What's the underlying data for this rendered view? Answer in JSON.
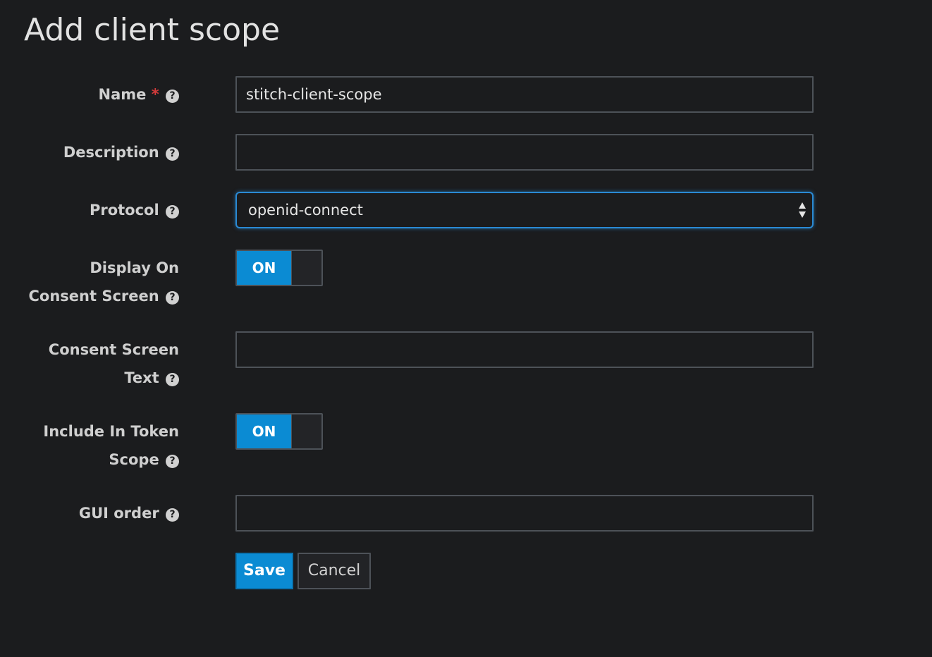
{
  "page": {
    "title": "Add client scope"
  },
  "form": {
    "name": {
      "label": "Name",
      "required_mark": "*",
      "value": "stitch-client-scope"
    },
    "description": {
      "label": "Description",
      "value": ""
    },
    "protocol": {
      "label": "Protocol",
      "selected": "openid-connect"
    },
    "display_on_consent": {
      "label_line1": "Display On",
      "label_line2": "Consent Screen",
      "state": "ON"
    },
    "consent_text": {
      "label_line1": "Consent Screen",
      "label_line2": "Text",
      "value": ""
    },
    "include_in_token_scope": {
      "label_line1": "Include In Token",
      "label_line2": "Scope",
      "state": "ON"
    },
    "gui_order": {
      "label": "GUI order",
      "value": ""
    }
  },
  "actions": {
    "save_label": "Save",
    "cancel_label": "Cancel"
  },
  "icons": {
    "help": "help-circle-icon",
    "select_arrows": "sort-arrows-icon"
  },
  "colors": {
    "background": "#1b1c1e",
    "accent": "#0b8bd3",
    "focus_border": "#2a8ad4",
    "required": "#d33b3b"
  }
}
